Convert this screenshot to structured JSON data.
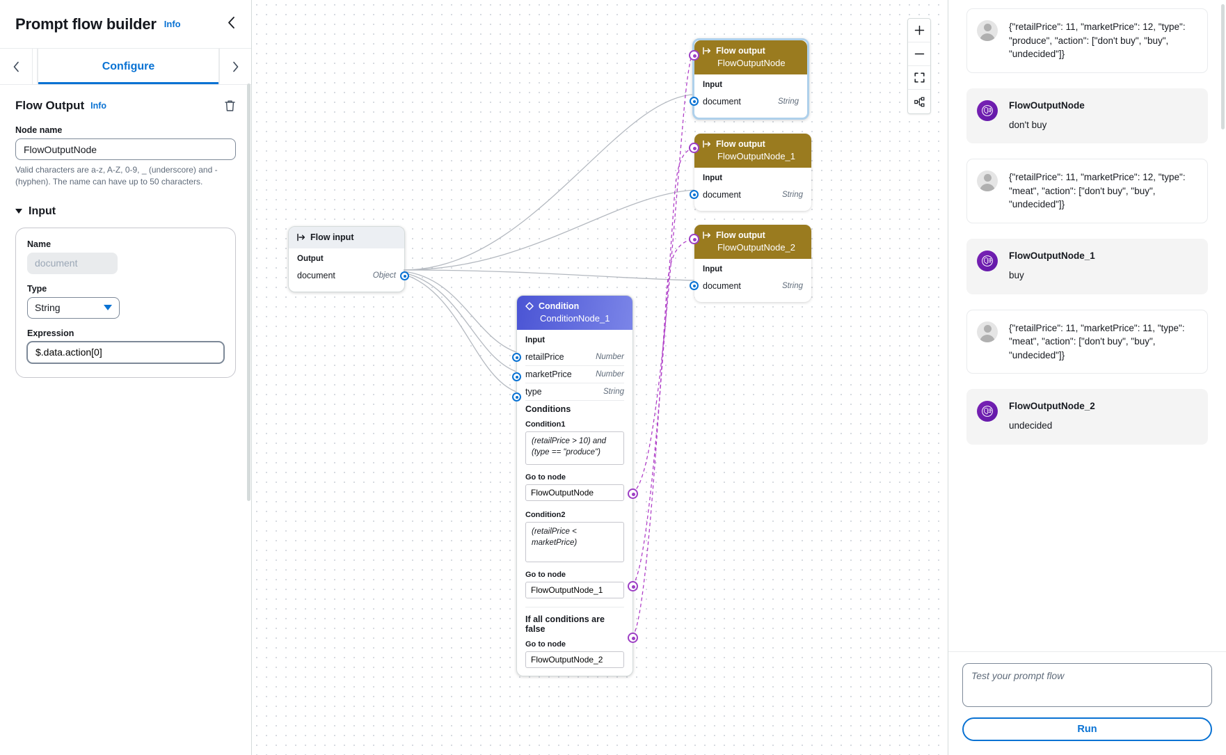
{
  "left_panel": {
    "title": "Prompt flow builder",
    "info_label": "Info",
    "collapse_icon": "chevron-left-icon",
    "tabs": {
      "prev_arrow": "chevron-left-icon",
      "next_arrow": "chevron-right-icon",
      "items": [
        {
          "label": "Configure",
          "active": true
        }
      ]
    },
    "section": {
      "title": "Flow Output",
      "info_label": "Info",
      "delete_icon": "trash-icon"
    },
    "node_name": {
      "label": "Node name",
      "value": "FlowOutputNode",
      "help": "Valid characters are a-z, A-Z, 0-9, _ (underscore) and -(hyphen). The name can have up to 50 characters."
    },
    "input_section": {
      "title": "Input",
      "name_label": "Name",
      "name_value": "document",
      "type_label": "Type",
      "type_value": "String",
      "type_caret": "chevron-down-icon",
      "expression_label": "Expression",
      "expression_value": "$.data.action[0]"
    }
  },
  "canvas": {
    "controls": [
      {
        "name": "zoom-in-button",
        "glyph": "+"
      },
      {
        "name": "zoom-out-button",
        "glyph": "−"
      },
      {
        "name": "fit-to-screen-button",
        "glyph": "fit-icon"
      },
      {
        "name": "auto-layout-button",
        "glyph": "layout-icon"
      }
    ],
    "flow_input_node": {
      "header_icon": "flow-input-icon",
      "header": "Flow input",
      "section_label": "Output",
      "port_name": "document",
      "port_type": "Object"
    },
    "output_nodes": [
      {
        "header_icon": "flow-output-icon",
        "header": "Flow output",
        "name": "FlowOutputNode",
        "section_label": "Input",
        "port_name": "document",
        "port_type": "String",
        "selected": true
      },
      {
        "header_icon": "flow-output-icon",
        "header": "Flow output",
        "name": "FlowOutputNode_1",
        "section_label": "Input",
        "port_name": "document",
        "port_type": "String",
        "selected": false
      },
      {
        "header_icon": "flow-output-icon",
        "header": "Flow output",
        "name": "FlowOutputNode_2",
        "section_label": "Input",
        "port_name": "document",
        "port_type": "String",
        "selected": false
      }
    ],
    "condition_node": {
      "header_icon": "condition-diamond-icon",
      "header": "Condition",
      "name": "ConditionNode_1",
      "input_label": "Input",
      "inputs": [
        {
          "name": "retailPrice",
          "type": "Number"
        },
        {
          "name": "marketPrice",
          "type": "Number"
        },
        {
          "name": "type",
          "type": "String"
        }
      ],
      "conditions_label": "Conditions",
      "condition1_label": "Condition1",
      "condition1_value": "(retailPrice > 10) and (type == \"produce\")",
      "goto1_label": "Go to node",
      "goto1_value": "FlowOutputNode",
      "condition2_label": "Condition2",
      "condition2_value": "(retailPrice < marketPrice)",
      "goto2_label": "Go to node",
      "goto2_value": "FlowOutputNode_1",
      "else_title": "If all conditions are false",
      "goto3_label": "Go to node",
      "goto3_value": "FlowOutputNode_2"
    }
  },
  "test_panel": {
    "messages": [
      {
        "role": "user",
        "avatar": "user-avatar-icon",
        "text": "{\"retailPrice\": 11, \"marketPrice\": 12, \"type\": \"produce\", \"action\": [\"don't buy\", \"buy\", \"undecided\"]}"
      },
      {
        "role": "bot",
        "avatar": "flow-bot-icon",
        "title": "FlowOutputNode",
        "text": "don't buy"
      },
      {
        "role": "user",
        "avatar": "user-avatar-icon",
        "text": "{\"retailPrice\": 11, \"marketPrice\": 12, \"type\": \"meat\", \"action\": [\"don't buy\", \"buy\", \"undecided\"]}"
      },
      {
        "role": "bot",
        "avatar": "flow-bot-icon",
        "title": "FlowOutputNode_1",
        "text": "buy"
      },
      {
        "role": "user",
        "avatar": "user-avatar-icon",
        "text": "{\"retailPrice\": 11, \"marketPrice\": 11, \"type\": \"meat\", \"action\": [\"don't buy\", \"buy\", \"undecided\"]}"
      },
      {
        "role": "bot",
        "avatar": "flow-bot-icon",
        "title": "FlowOutputNode_2",
        "text": "undecided"
      }
    ],
    "input_placeholder": "Test your prompt flow",
    "input_value": "",
    "run_label": "Run"
  },
  "colors": {
    "accent_blue": "#0972d3",
    "output_node": "#9a7b1f",
    "condition_node": "#4a54d4",
    "purple_port": "#9d3fc4",
    "bot_avatar": "#6018a8"
  }
}
